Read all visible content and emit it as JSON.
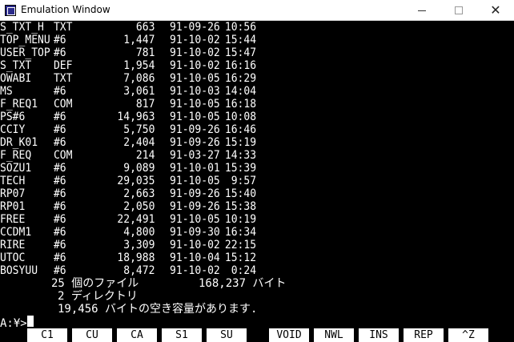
{
  "window": {
    "title": "Emulation Window",
    "minimize_icon": "minimize-icon",
    "maximize_icon": "maximize-icon",
    "close_icon": "close-icon"
  },
  "files": [
    {
      "name": "S_TXT_H",
      "ext": "TXT",
      "size": "663",
      "date": "91-09-26",
      "time": "10:56"
    },
    {
      "name": "TOP_MENU",
      "ext": "#6",
      "size": "1,447",
      "date": "91-10-02",
      "time": "15:44"
    },
    {
      "name": "USER_TOP",
      "ext": "#6",
      "size": "781",
      "date": "91-10-02",
      "time": "15:47"
    },
    {
      "name": "S_TXT",
      "ext": "DEF",
      "size": "1,954",
      "date": "91-10-02",
      "time": "16:16"
    },
    {
      "name": "OWABI",
      "ext": "TXT",
      "size": "7,086",
      "date": "91-10-05",
      "time": "16:29"
    },
    {
      "name": "MS",
      "ext": "#6",
      "size": "3,061",
      "date": "91-10-03",
      "time": "14:04"
    },
    {
      "name": "F_REQ1",
      "ext": "COM",
      "size": "817",
      "date": "91-10-05",
      "time": "16:18"
    },
    {
      "name": "PS#6",
      "ext": "#6",
      "size": "14,963",
      "date": "91-10-05",
      "time": "10:08"
    },
    {
      "name": "CCIY",
      "ext": "#6",
      "size": "5,750",
      "date": "91-09-26",
      "time": "16:46"
    },
    {
      "name": "DR_K01",
      "ext": "#6",
      "size": "2,404",
      "date": "91-09-26",
      "time": "15:19"
    },
    {
      "name": "F_REQ",
      "ext": "COM",
      "size": "214",
      "date": "91-03-27",
      "time": "14:33"
    },
    {
      "name": "SOZU1",
      "ext": "#6",
      "size": "9,089",
      "date": "91-10-01",
      "time": "15:39"
    },
    {
      "name": "TECH",
      "ext": "#6",
      "size": "29,035",
      "date": "91-10-05",
      "time": " 9:57"
    },
    {
      "name": "RP07",
      "ext": "#6",
      "size": "2,663",
      "date": "91-09-26",
      "time": "15:40"
    },
    {
      "name": "RP01",
      "ext": "#6",
      "size": "2,050",
      "date": "91-09-26",
      "time": "15:38"
    },
    {
      "name": "FREE",
      "ext": "#6",
      "size": "22,491",
      "date": "91-10-05",
      "time": "10:19"
    },
    {
      "name": "CCDM1",
      "ext": "#6",
      "size": "4,800",
      "date": "91-09-30",
      "time": "16:34"
    },
    {
      "name": "RIRE",
      "ext": "#6",
      "size": "3,309",
      "date": "91-10-02",
      "time": "22:15"
    },
    {
      "name": "UTOC",
      "ext": "#6",
      "size": "18,988",
      "date": "91-10-04",
      "time": "15:12"
    },
    {
      "name": "BOSYUU",
      "ext": "#6",
      "size": "8,472",
      "date": "91-10-02",
      "time": " 0:24"
    }
  ],
  "summary": {
    "file_count": "25 個のファイル",
    "file_bytes": "168,237 バイト",
    "dir_count": "2 ディレクトリ",
    "free_space": "19,456 バイトの空き容量があります."
  },
  "prompt": "A:¥>",
  "function_keys": [
    "C1",
    "CU",
    "CA",
    "S1",
    "SU",
    "VOID",
    "NWL",
    "INS",
    "REP",
    "^Z"
  ]
}
